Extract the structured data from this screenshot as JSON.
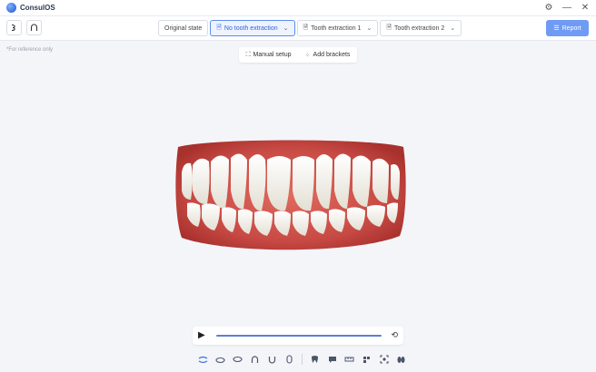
{
  "app": {
    "name": "ConsulOS",
    "logo_icon": "consulos-logo-icon"
  },
  "window_controls": [
    {
      "name": "settings-icon",
      "glyph": "⚙"
    },
    {
      "name": "minimize-icon",
      "glyph": "—"
    },
    {
      "name": "close-icon",
      "glyph": "✕"
    }
  ],
  "toolbar": {
    "left_buttons": [
      {
        "name": "upper-jaw-toggle-icon",
        "glyph": "ᕲ"
      },
      {
        "name": "arch-view-icon",
        "glyph": "∩"
      }
    ],
    "tabs": [
      {
        "label": "Original state",
        "active": false,
        "has_doc_icon": false,
        "has_chevron": false
      },
      {
        "label": "No tooth extraction",
        "active": true,
        "has_doc_icon": true,
        "has_chevron": true
      },
      {
        "label": "Tooth extraction 1",
        "active": false,
        "has_doc_icon": true,
        "has_chevron": true
      },
      {
        "label": "Tooth extraction 2",
        "active": false,
        "has_doc_icon": true,
        "has_chevron": true
      }
    ],
    "report_label": "Report"
  },
  "reference_note": "*For reference only",
  "setup_bar": {
    "manual_setup_label": "Manual setup",
    "add_brackets_label": "Add brackets"
  },
  "colors": {
    "accent": "#5b8def",
    "report_button": "#6f9bf5",
    "background": "#f4f5f9",
    "gum": "#c84a44",
    "tooth": "#f3f1ea"
  },
  "player": {
    "progress": 1.0
  },
  "bottom_toolbar": [
    "occlusion-icon",
    "upper-jaw-icon",
    "lower-jaw-icon",
    "upper-arch-icon",
    "lower-arch-icon",
    "both-arch-icon",
    "separator",
    "tooth-icon",
    "comment-icon",
    "measure-icon",
    "grid-icon",
    "fit-view-icon",
    "foot-icon"
  ]
}
